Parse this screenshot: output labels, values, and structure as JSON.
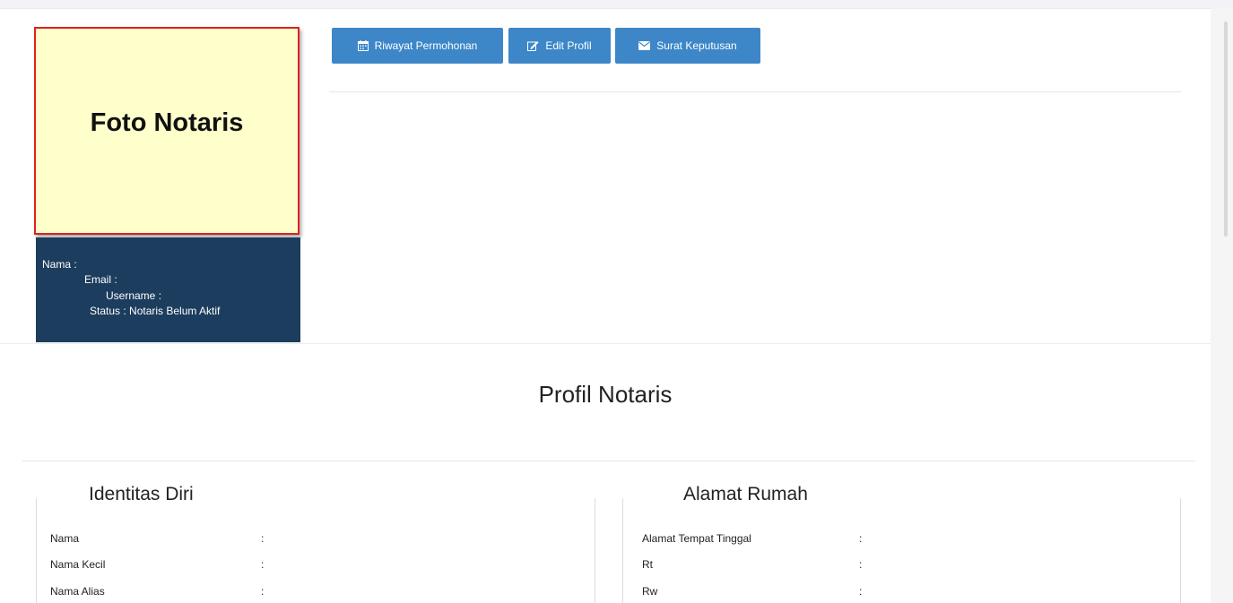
{
  "photo": {
    "placeholder": "Foto Notaris"
  },
  "info": {
    "nama": "Nama :",
    "email": "Email :",
    "username": "Username :",
    "status": "Status : Notaris Belum Aktif"
  },
  "toolbar": {
    "riwayat": {
      "label": "Riwayat Permohonan",
      "icon": "calendar-icon"
    },
    "edit": {
      "label": "Edit Profil",
      "icon": "edit-icon"
    },
    "surat": {
      "label": "Surat Keputusan",
      "icon": "envelope-icon"
    },
    "button_color": "#3d87c8"
  },
  "profile": {
    "title": "Profil Notaris",
    "identity": {
      "title": "Identitas Diri",
      "rows": [
        {
          "label": "Nama",
          "sep": ":"
        },
        {
          "label": "Nama Kecil",
          "sep": ":"
        },
        {
          "label": "Nama Alias",
          "sep": ":"
        }
      ]
    },
    "address": {
      "title": "Alamat Rumah",
      "rows": [
        {
          "label": "Alamat Tempat Tinggal",
          "sep": ":"
        },
        {
          "label": "Rt",
          "sep": ":"
        },
        {
          "label": "Rw",
          "sep": ":"
        }
      ]
    }
  },
  "colors": {
    "panel": "#1c3d5d",
    "photo_bg": "#ffffcc",
    "photo_border": "#e02020"
  }
}
